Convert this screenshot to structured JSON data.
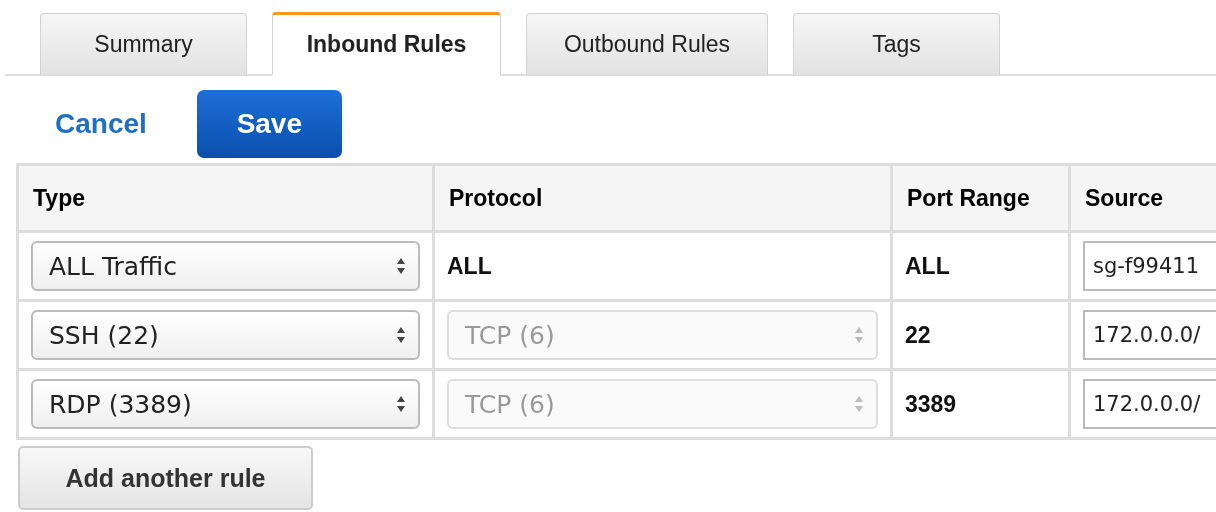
{
  "tabs": [
    {
      "label": "Summary",
      "selected": false
    },
    {
      "label": "Inbound Rules",
      "selected": true
    },
    {
      "label": "Outbound Rules",
      "selected": false
    },
    {
      "label": "Tags",
      "selected": false
    }
  ],
  "actions": {
    "cancel": "Cancel",
    "save": "Save"
  },
  "table": {
    "columns": [
      "Type",
      "Protocol",
      "Port Range",
      "Source"
    ],
    "rows": [
      {
        "type": "ALL Traffic",
        "protocol": {
          "kind": "text",
          "value": "ALL",
          "disabled": false
        },
        "port_range": "ALL",
        "source": "sg-f99411"
      },
      {
        "type": "SSH (22)",
        "protocol": {
          "kind": "select",
          "value": "TCP (6)",
          "disabled": true
        },
        "port_range": "22",
        "source": "172.0.0.0/"
      },
      {
        "type": "RDP (3389)",
        "protocol": {
          "kind": "select",
          "value": "TCP (6)",
          "disabled": true
        },
        "port_range": "3389",
        "source": "172.0.0.0/"
      }
    ]
  },
  "add_rule_button": "Add another rule"
}
